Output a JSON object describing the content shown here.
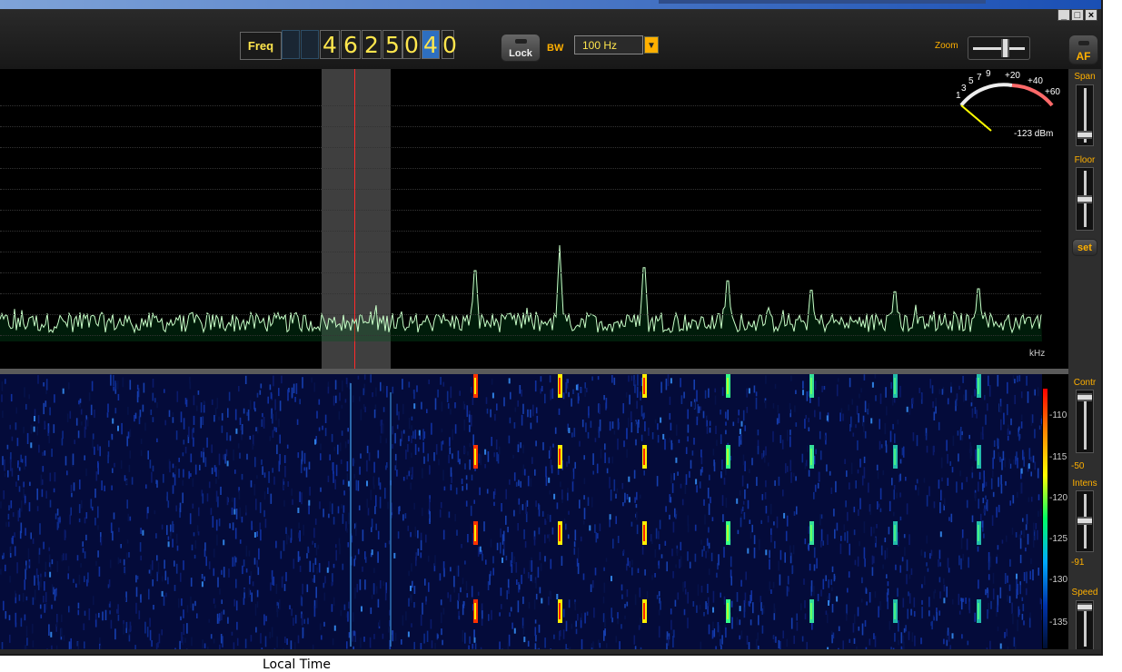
{
  "window": {
    "controls": {
      "minimize": "_",
      "maximize": "□",
      "close": "×"
    }
  },
  "toolbar": {
    "freq_label": "Freq",
    "freq_digits": [
      "",
      "",
      "4",
      "6",
      "2",
      "5",
      "0",
      "4",
      "0"
    ],
    "freq_selected_digit_index": 7,
    "lock_label": "Lock",
    "bw_label": "BW",
    "bw_value": "100 Hz",
    "zoom_label": "Zoom",
    "af_label": "AF"
  },
  "spectrum": {
    "unit_label": "kHz",
    "passband_color": "#8c8c8c",
    "center_line_color": "#ff2a2a",
    "trace_color": "#c8ffc8",
    "peaks_count": 7
  },
  "smeter": {
    "scale_labels": [
      "1",
      "3",
      "5",
      "7",
      "9",
      "+20",
      "+40",
      "+60"
    ],
    "reading": "-123 dBm"
  },
  "sidebar": {
    "span_label": "Span",
    "floor_label": "Floor",
    "set_label": "set",
    "contr_label": "Contr",
    "contr_value": "-50",
    "intens_label": "Intens",
    "intens_value": "-91",
    "speed_label": "Speed"
  },
  "waterfall": {
    "colorbar_ticks": [
      "-110",
      "-115",
      "-120",
      "-125",
      "-130",
      "-135"
    ]
  },
  "footer": {
    "local_time_label": "Local Time"
  }
}
